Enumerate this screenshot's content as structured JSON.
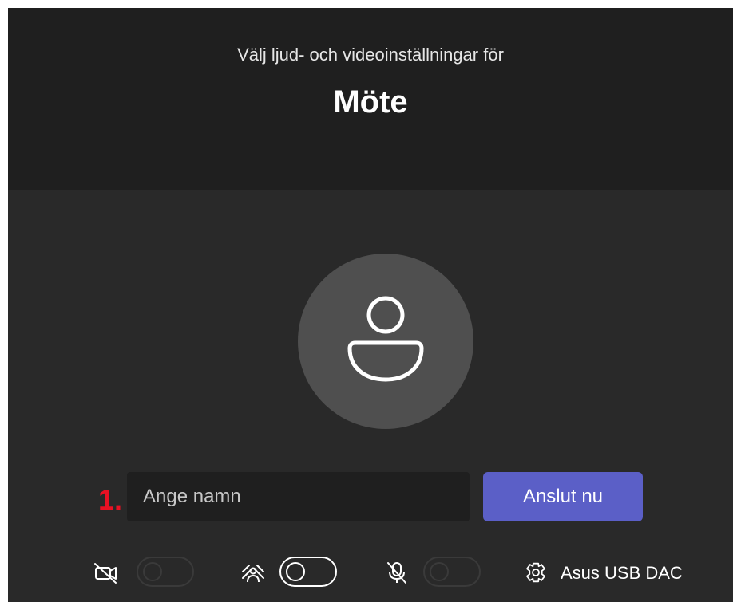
{
  "header": {
    "subtitle": "Välj ljud- och videoinställningar för",
    "meeting_title": "Möte"
  },
  "step_marker": "1.",
  "name_input": {
    "value": "",
    "placeholder": "Ange namn"
  },
  "join_button_label": "Anslut nu",
  "controls": {
    "camera": {
      "icon": "camera-off-icon",
      "enabled": false
    },
    "background_effects": {
      "icon": "background-effects-icon",
      "enabled": false
    },
    "microphone": {
      "icon": "microphone-off-icon",
      "enabled": false
    },
    "device_settings": {
      "icon": "gear-icon",
      "label": "Asus USB DAC"
    }
  },
  "colors": {
    "header_bg": "#1f1f1f",
    "body_bg": "#292929",
    "avatar_bg": "#4f4f4f",
    "accent": "#5b5fc7",
    "step_marker": "#e81123"
  }
}
